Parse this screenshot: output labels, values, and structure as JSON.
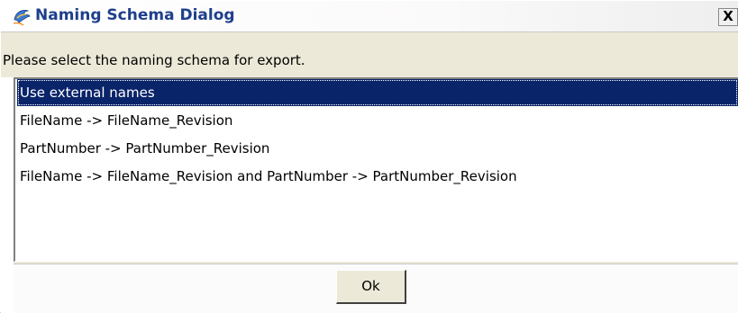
{
  "window": {
    "title": "Naming Schema Dialog",
    "close_label": "X"
  },
  "prompt": {
    "text": "Please select the naming schema for export."
  },
  "list": {
    "items": [
      {
        "label": "Use external names",
        "selected": true
      },
      {
        "label": "FileName -> FileName_Revision",
        "selected": false
      },
      {
        "label": "PartNumber -> PartNumber_Revision",
        "selected": false
      },
      {
        "label": "FileName -> FileName_Revision and PartNumber -> PartNumber_Revision",
        "selected": false
      }
    ]
  },
  "buttons": {
    "ok_label": "Ok"
  },
  "colors": {
    "title_text": "#1e3f8c",
    "selection_bg": "#0a246a",
    "selection_fg": "#ffffff",
    "dialog_bg": "#ece9d8"
  },
  "icons": {
    "app_icon": "dolphin-app-icon",
    "close_icon": "close-icon"
  }
}
